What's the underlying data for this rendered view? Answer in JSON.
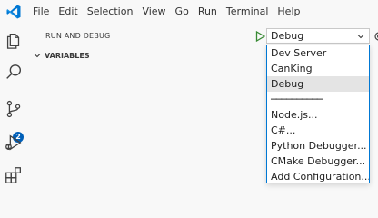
{
  "menubar": {
    "items": [
      "File",
      "Edit",
      "Selection",
      "View",
      "Go",
      "Run",
      "Terminal",
      "Help"
    ]
  },
  "activity": {
    "scm_badge": "2",
    "icons": [
      "explorer-icon",
      "search-icon",
      "source-control-icon",
      "run-debug-icon",
      "extensions-icon"
    ]
  },
  "sidebar": {
    "title": "RUN AND DEBUG",
    "section": "VARIABLES",
    "selected_config": "Debug"
  },
  "dropdown": {
    "options": [
      {
        "label": "Dev Server"
      },
      {
        "label": "CanKing"
      },
      {
        "label": "Debug",
        "selected": true
      },
      {
        "label": "──────────",
        "separator": true
      },
      {
        "label": "Node.js..."
      },
      {
        "label": "C#..."
      },
      {
        "label": "Python Debugger..."
      },
      {
        "label": "CMake Debugger..."
      },
      {
        "label": "Add Configuration..."
      }
    ]
  },
  "colors": {
    "accent": "#005fb8",
    "vscode_blue": "#0078d4",
    "run_green": "#388a34",
    "background": "#f8f8f8"
  }
}
